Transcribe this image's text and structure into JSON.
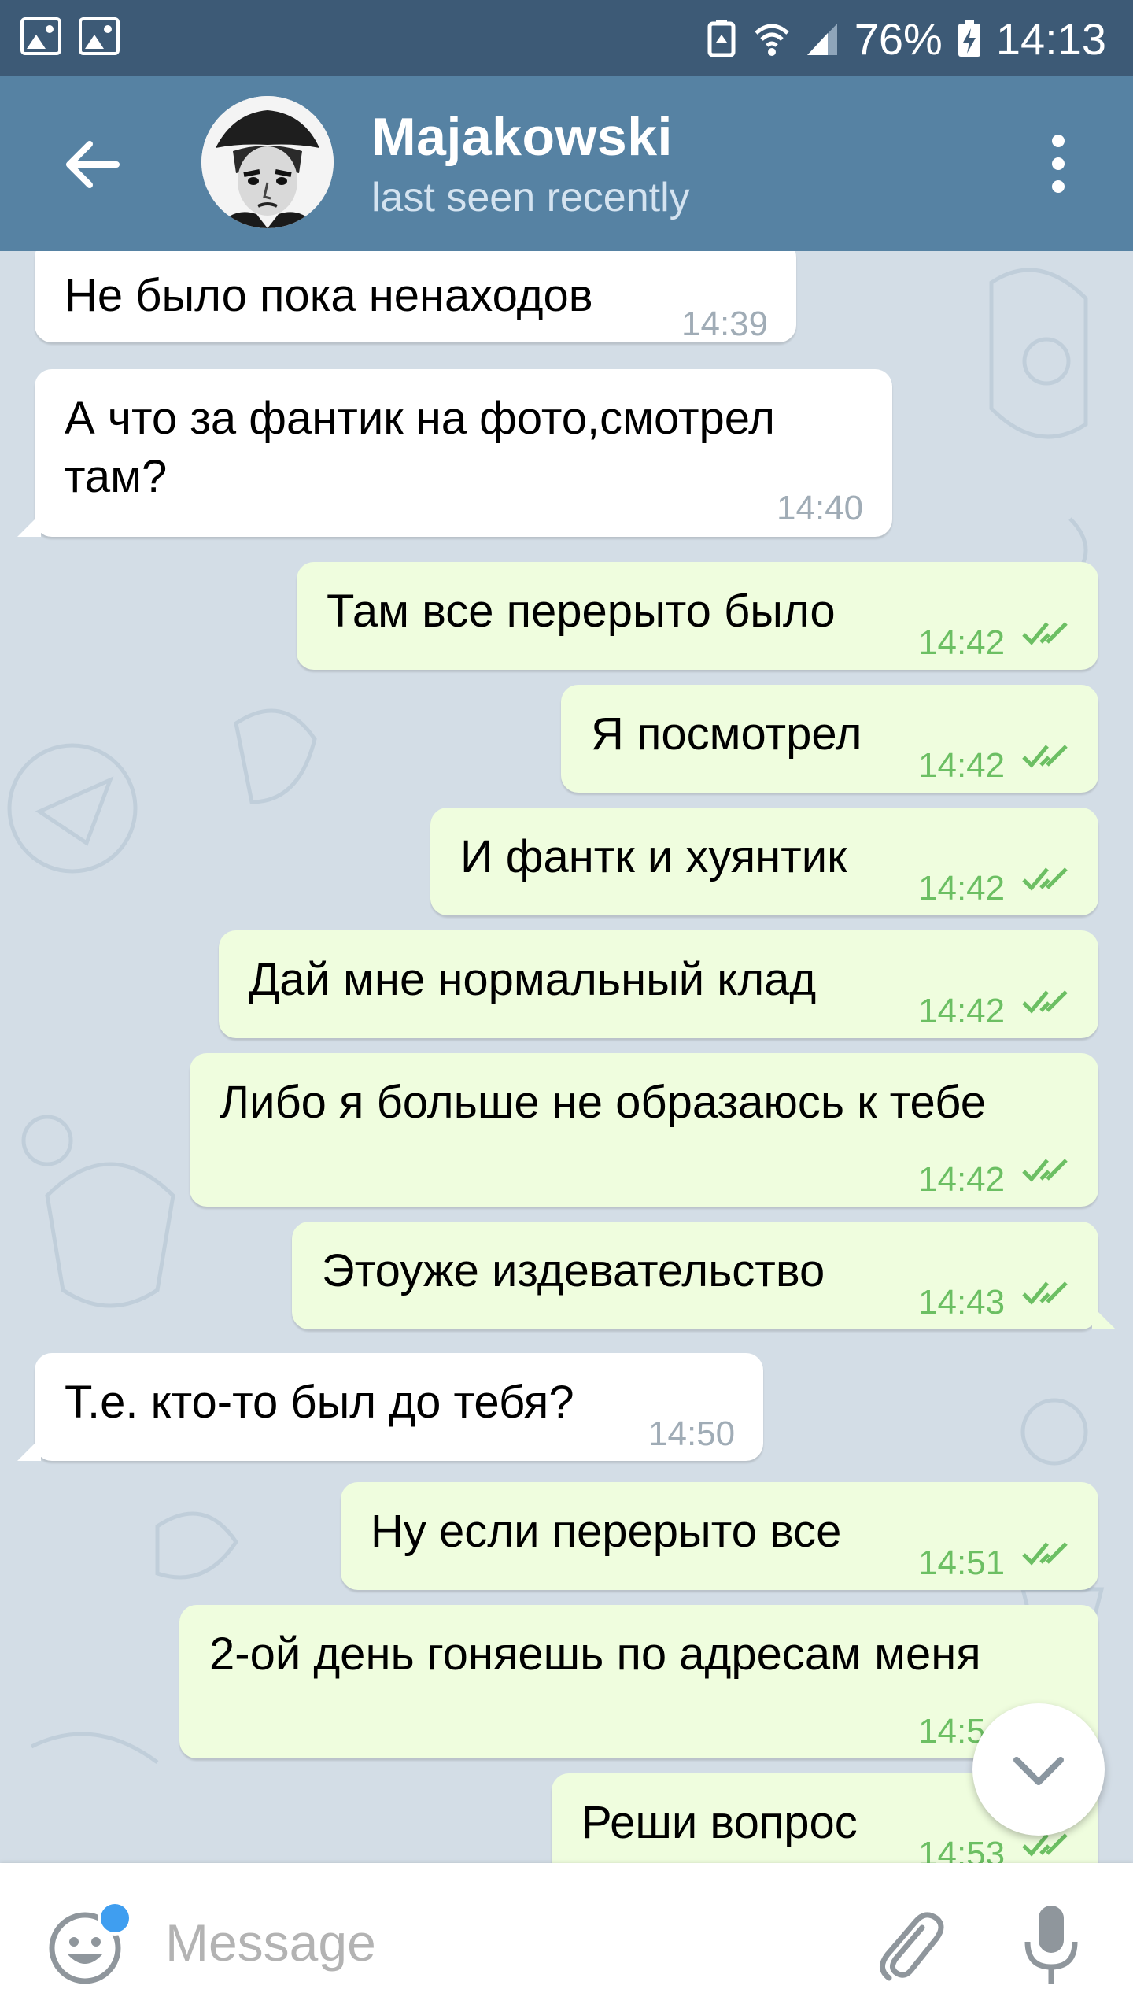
{
  "status_bar": {
    "battery": "76%",
    "time": "14:13"
  },
  "header": {
    "contact_name": "Majakowski",
    "status": "last seen recently"
  },
  "messages": [
    {
      "dir": "in",
      "text": "Не было пока ненаходов",
      "time": "14:39"
    },
    {
      "dir": "in",
      "text": "А что за фантик на фото,смотрел\nтам?",
      "time": "14:40"
    },
    {
      "dir": "out",
      "text": "Там все перерыто было",
      "time": "14:42"
    },
    {
      "dir": "out",
      "text": "Я посмотрел",
      "time": "14:42"
    },
    {
      "dir": "out",
      "text": "И фантк и хуянтик",
      "time": "14:42"
    },
    {
      "dir": "out",
      "text": "Дай мне нормальный клад",
      "time": "14:42"
    },
    {
      "dir": "out",
      "text": "Либо я больше не образаюсь к тебе",
      "time": "14:42"
    },
    {
      "dir": "out",
      "text": "Этоуже издевательство",
      "time": "14:43"
    },
    {
      "dir": "in",
      "text": "Т.е. кто-то был до тебя?",
      "time": "14:50"
    },
    {
      "dir": "out",
      "text": "Ну если перерыто все",
      "time": "14:51"
    },
    {
      "dir": "out",
      "text": "2-ой день гоняешь по адресам меня",
      "time": "14:5"
    },
    {
      "dir": "out",
      "text": "Реши вопрос",
      "time": "14:53"
    }
  ],
  "input": {
    "placeholder": "Message"
  },
  "icons": {
    "back": "arrow-left-icon",
    "menu": "more-vertical-icon",
    "emoji": "emoji-icon",
    "attach": "paperclip-icon",
    "mic": "microphone-icon",
    "scroll": "chevron-down-icon"
  },
  "colors": {
    "header": "#5682a3",
    "status_bar": "#3d5a76",
    "outgoing_bubble": "#effdde",
    "incoming_bubble": "#ffffff",
    "read_ticks": "#6cbf63",
    "chat_background": "#d3dde6",
    "unread_dot": "#3f9ef0"
  }
}
